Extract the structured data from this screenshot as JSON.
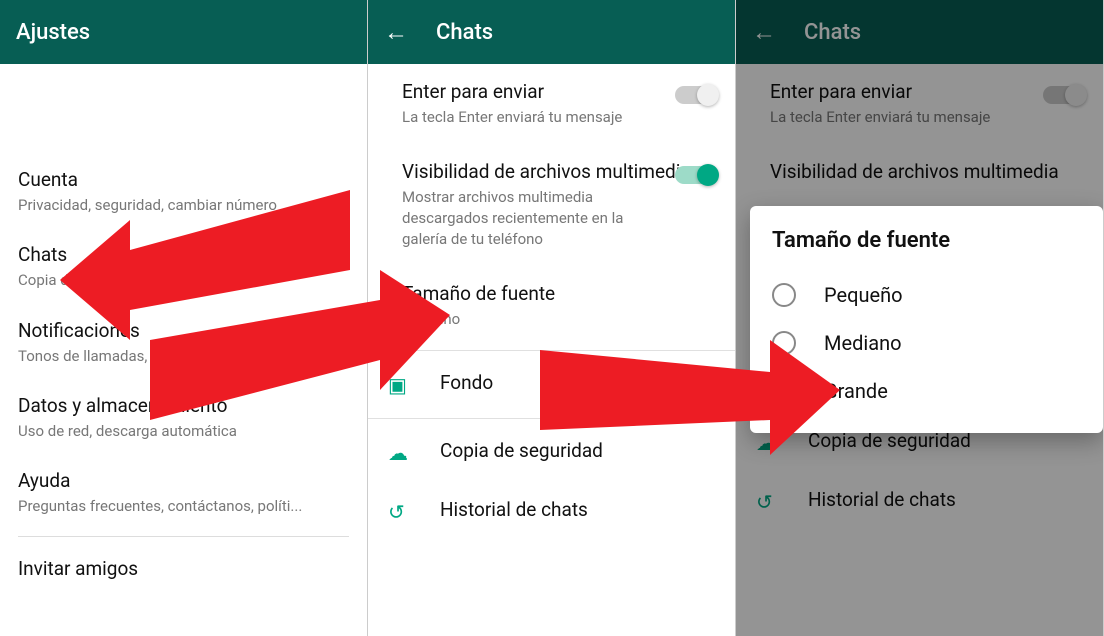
{
  "screen1": {
    "header": "Ajustes",
    "items": [
      {
        "title": "Cuenta",
        "sub": "Privacidad, seguridad, cambiar número"
      },
      {
        "title": "Chats",
        "sub": "Copia de seguridad, historial, fondo"
      },
      {
        "title": "Notificaciones",
        "sub": "Tonos de llamadas, mensajes"
      },
      {
        "title": "Datos y almacenamiento",
        "sub": "Uso de red, descarga automática"
      },
      {
        "title": "Ayuda",
        "sub": "Preguntas frecuentes, contáctanos, políti..."
      },
      {
        "title": "Invitar amigos",
        "sub": ""
      }
    ]
  },
  "screen2": {
    "header": "Chats",
    "enter": {
      "title": "Enter para enviar",
      "sub": "La tecla Enter enviará tu mensaje"
    },
    "media": {
      "title": "Visibilidad de archivos multimedia",
      "sub": "Mostrar archivos multimedia descargados recientemente en la galería de tu teléfono"
    },
    "fontsize": {
      "title": "Tamaño de fuente",
      "sub": "Mediano"
    },
    "wallpaper": "Fondo",
    "backup": "Copia de seguridad",
    "history": "Historial de chats"
  },
  "screen3": {
    "header": "Chats",
    "enter": {
      "title": "Enter para enviar",
      "sub": "La tecla Enter enviará tu mensaje"
    },
    "media": {
      "title": "Visibilidad de archivos multimedia",
      "sub": ""
    },
    "backup": "Copia de seguridad",
    "history": "Historial de chats",
    "dialog": {
      "title": "Tamaño de fuente",
      "options": [
        "Pequeño",
        "Mediano",
        "Grande"
      ],
      "selected": 2
    }
  },
  "colors": {
    "brand": "#075E54",
    "accent": "#00a884",
    "arrow": "#ed1c24"
  }
}
